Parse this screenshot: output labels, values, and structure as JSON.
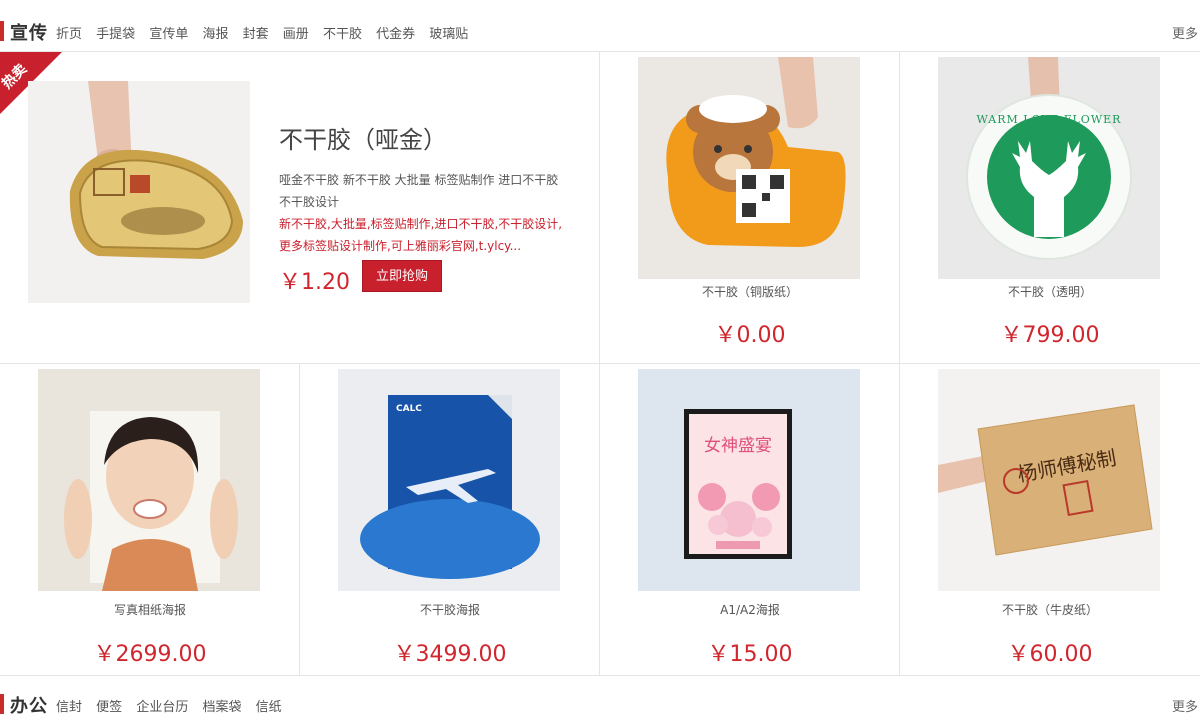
{
  "section1": {
    "title": "宣传",
    "links": [
      "折页",
      "手提袋",
      "宣传单",
      "海报",
      "封套",
      "画册",
      "不干胶",
      "代金券",
      "玻璃贴"
    ],
    "more": "更多"
  },
  "featured": {
    "ribbon": "热卖",
    "title": "不干胶（哑金）",
    "desc": "哑金不干胶 新不干胶 大批量 标签贴制作 进口不干胶 不干胶设计",
    "desc_red": "新不干胶,大批量,标签贴制作,进口不干胶,不干胶设计,更多标签贴设计制作,可上雅丽彩官网,t.ylcy...",
    "price": "￥1.20",
    "buy_label": "立即抢购"
  },
  "products": [
    {
      "name": "不干胶（铜版纸）",
      "price": "￥0.00",
      "image_icon": "bear-sticker-image"
    },
    {
      "name": "不干胶（透明）",
      "price": "￥799.00",
      "image_icon": "deer-sticker-image",
      "image_text": "WARM LOVE FLOWER"
    },
    {
      "name": "写真相纸海报",
      "price": "￥2699.00",
      "image_icon": "portrait-poster-image"
    },
    {
      "name": "不干胶海报",
      "price": "￥3499.00",
      "image_icon": "airplane-poster-image",
      "image_text": "CALC"
    },
    {
      "name": "A1/A2海报",
      "price": "￥15.00",
      "image_icon": "festival-poster-image",
      "image_text": "女神盛宴"
    },
    {
      "name": "不干胶（牛皮纸）",
      "price": "￥60.00",
      "image_icon": "kraft-card-image",
      "image_text": "杨师傅秘制"
    }
  ],
  "section2": {
    "title": "办公",
    "links": [
      "信封",
      "便签",
      "企业台历",
      "档案袋",
      "信纸"
    ],
    "more": "更多"
  },
  "colors": {
    "accent": "#c8202c",
    "price": "#d0262e",
    "border": "#e5e5e5"
  }
}
